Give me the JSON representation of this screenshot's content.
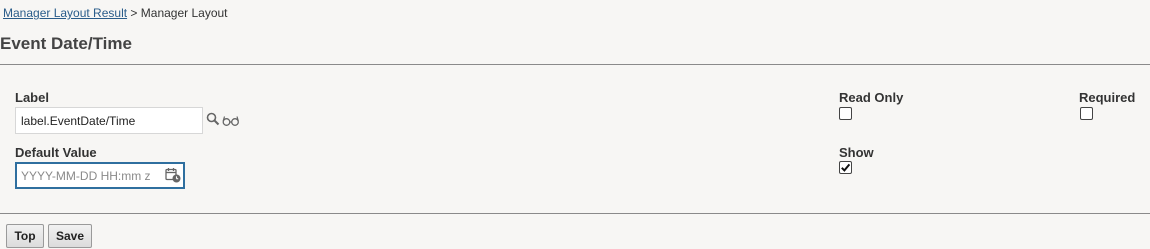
{
  "breadcrumb": {
    "link": "Manager Layout Result",
    "separator": ">",
    "current": "Manager Layout"
  },
  "page": {
    "title": "Event Date/Time"
  },
  "form": {
    "label": {
      "caption": "Label",
      "value": "label.EventDate/Time"
    },
    "default_value": {
      "caption": "Default Value",
      "placeholder": "YYYY-MM-DD HH:mm z"
    },
    "read_only": {
      "caption": "Read Only",
      "checked": false
    },
    "required": {
      "caption": "Required",
      "checked": false
    },
    "show": {
      "caption": "Show",
      "checked": true
    }
  },
  "buttons": {
    "top": "Top",
    "save": "Save"
  },
  "colors": {
    "background": "#f7f6f4",
    "link": "#2a5c8a",
    "focus_border": "#2f6f9f"
  },
  "icons": {
    "lookup": "search-icon",
    "translations": "glasses-icon",
    "date_picker": "calendar-clock-icon"
  }
}
